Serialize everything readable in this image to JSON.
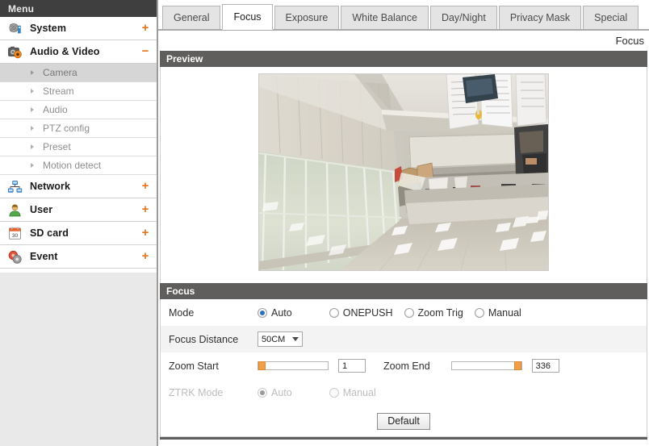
{
  "sidebar": {
    "header": "Menu",
    "groups": [
      {
        "label": "System",
        "icon": "system-gear-icon",
        "expander": "+",
        "expanded": false,
        "children": []
      },
      {
        "label": "Audio & Video",
        "icon": "camera-icon",
        "expander": "−",
        "expanded": true,
        "children": [
          {
            "label": "Camera",
            "active": true
          },
          {
            "label": "Stream",
            "active": false
          },
          {
            "label": "Audio",
            "active": false
          },
          {
            "label": "PTZ config",
            "active": false
          },
          {
            "label": "Preset",
            "active": false
          },
          {
            "label": "Motion detect",
            "active": false
          }
        ]
      },
      {
        "label": "Network",
        "icon": "network-icon",
        "expander": "+",
        "expanded": false,
        "children": []
      },
      {
        "label": "User",
        "icon": "user-icon",
        "expander": "+",
        "expanded": false,
        "children": []
      },
      {
        "label": "SD card",
        "icon": "sdcard-icon",
        "expander": "+",
        "expanded": false,
        "children": []
      },
      {
        "label": "Event",
        "icon": "event-icon",
        "expander": "+",
        "expanded": false,
        "children": []
      }
    ]
  },
  "tabs": [
    {
      "label": "General",
      "selected": false
    },
    {
      "label": "Focus",
      "selected": true
    },
    {
      "label": "Exposure",
      "selected": false
    },
    {
      "label": "White Balance",
      "selected": false
    },
    {
      "label": "Day/Night",
      "selected": false
    },
    {
      "label": "Privacy Mask",
      "selected": false
    },
    {
      "label": "Special",
      "selected": false
    }
  ],
  "page_title": "Focus",
  "preview": {
    "header": "Preview"
  },
  "focus": {
    "header": "Focus",
    "mode": {
      "label": "Mode",
      "options": [
        {
          "label": "Auto",
          "checked": true
        },
        {
          "label": "ONEPUSH",
          "checked": false
        },
        {
          "label": "Zoom Trig",
          "checked": false
        },
        {
          "label": "Manual",
          "checked": false
        }
      ]
    },
    "focus_distance": {
      "label": "Focus Distance",
      "value": "50CM",
      "options": [
        "50CM"
      ]
    },
    "zoom_start": {
      "label": "Zoom Start",
      "value": "1",
      "slider_percent": 0
    },
    "zoom_end": {
      "label": "Zoom End",
      "value": "336",
      "slider_percent": 100
    },
    "ztrk_mode": {
      "label": "ZTRK Mode",
      "disabled": true,
      "options": [
        {
          "label": "Auto",
          "checked": true
        },
        {
          "label": "Manual",
          "checked": false
        }
      ]
    },
    "default_button": "Default"
  },
  "colors": {
    "accent_orange": "#e8741c",
    "header_bar": "#5f5e5c",
    "menu_bar": "#3f3f3f",
    "radio_blue": "#2c6fbb",
    "slider_handle": "#f0a04b",
    "active_item_bg": "#d6d6d6"
  }
}
